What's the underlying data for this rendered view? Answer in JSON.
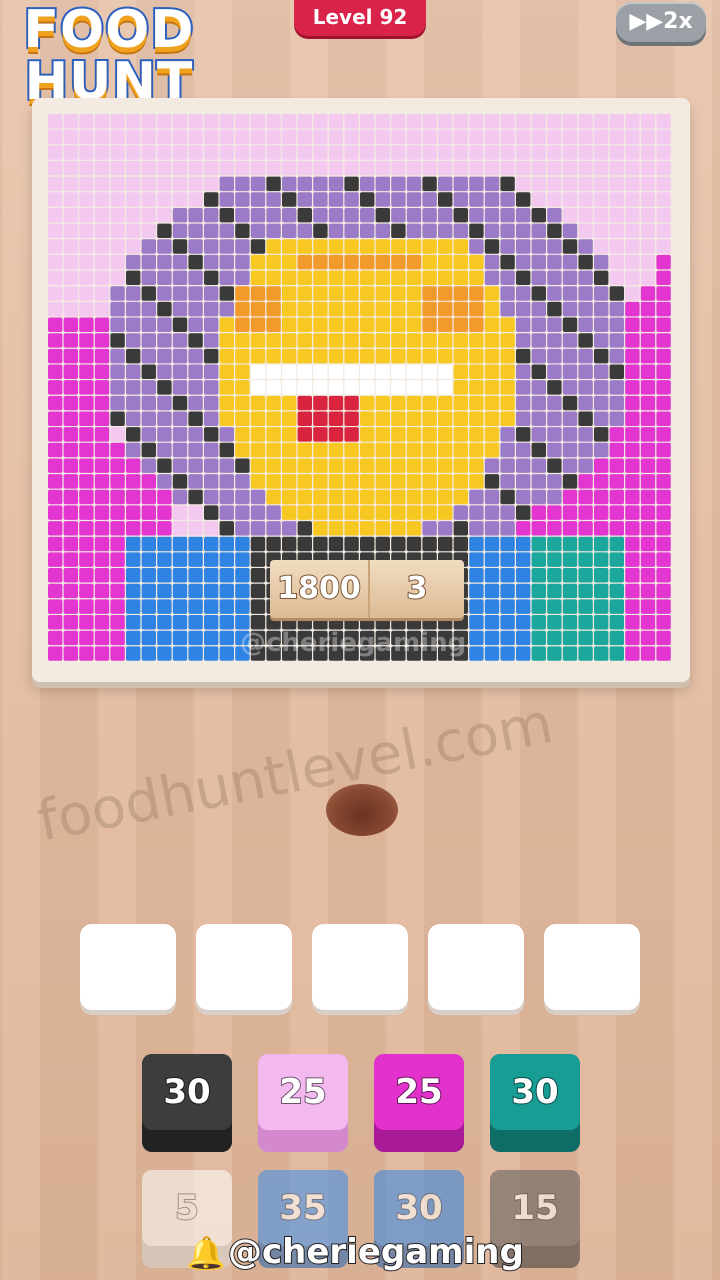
{
  "app": {
    "logo_line1": "FOOD",
    "logo_line2": "HUNT",
    "level_label": "Level 92",
    "speed_label": "▶▶2x"
  },
  "board": {
    "score": "1800",
    "multiplier": "3",
    "overlay_handle": "@cheriegaming",
    "grid_columns": 40,
    "grid_rows": 35,
    "colors": {
      "light_pink": "#f3c9ef",
      "magenta": "#e335cf",
      "purple": "#9b7ac8",
      "dark": "#3a3a3a",
      "yellow": "#f7c722",
      "orange": "#f39a2c",
      "white": "#ffffff",
      "cyan": "#57d3ea",
      "red": "#d8243e",
      "blue": "#2f83e3",
      "teal": "#1ba79b"
    }
  },
  "watermark": "foodhuntlevel.com",
  "slots_count": 5,
  "tiles": [
    {
      "value": "30",
      "color": "#3d3d3d",
      "edge": "#222222"
    },
    {
      "value": "25",
      "color": "#f3b8ee",
      "edge": "#d489cf"
    },
    {
      "value": "25",
      "color": "#e332cc",
      "edge": "#a81a98"
    },
    {
      "value": "30",
      "color": "#189d95",
      "edge": "#0e6d67"
    },
    {
      "value": "5",
      "color": "#ffffff",
      "edge": "#d6d6d6",
      "faded": true
    },
    {
      "value": "35",
      "color": "#3a8ff0",
      "edge": "#2264b5",
      "faded": true
    },
    {
      "value": "30",
      "color": "#2f86e6",
      "edge": "#1f5fae",
      "faded": true
    },
    {
      "value": "15",
      "color": "#5a5a5a",
      "edge": "#3a3a3a",
      "faded": true
    }
  ],
  "footer_handle": "@cheriegaming"
}
